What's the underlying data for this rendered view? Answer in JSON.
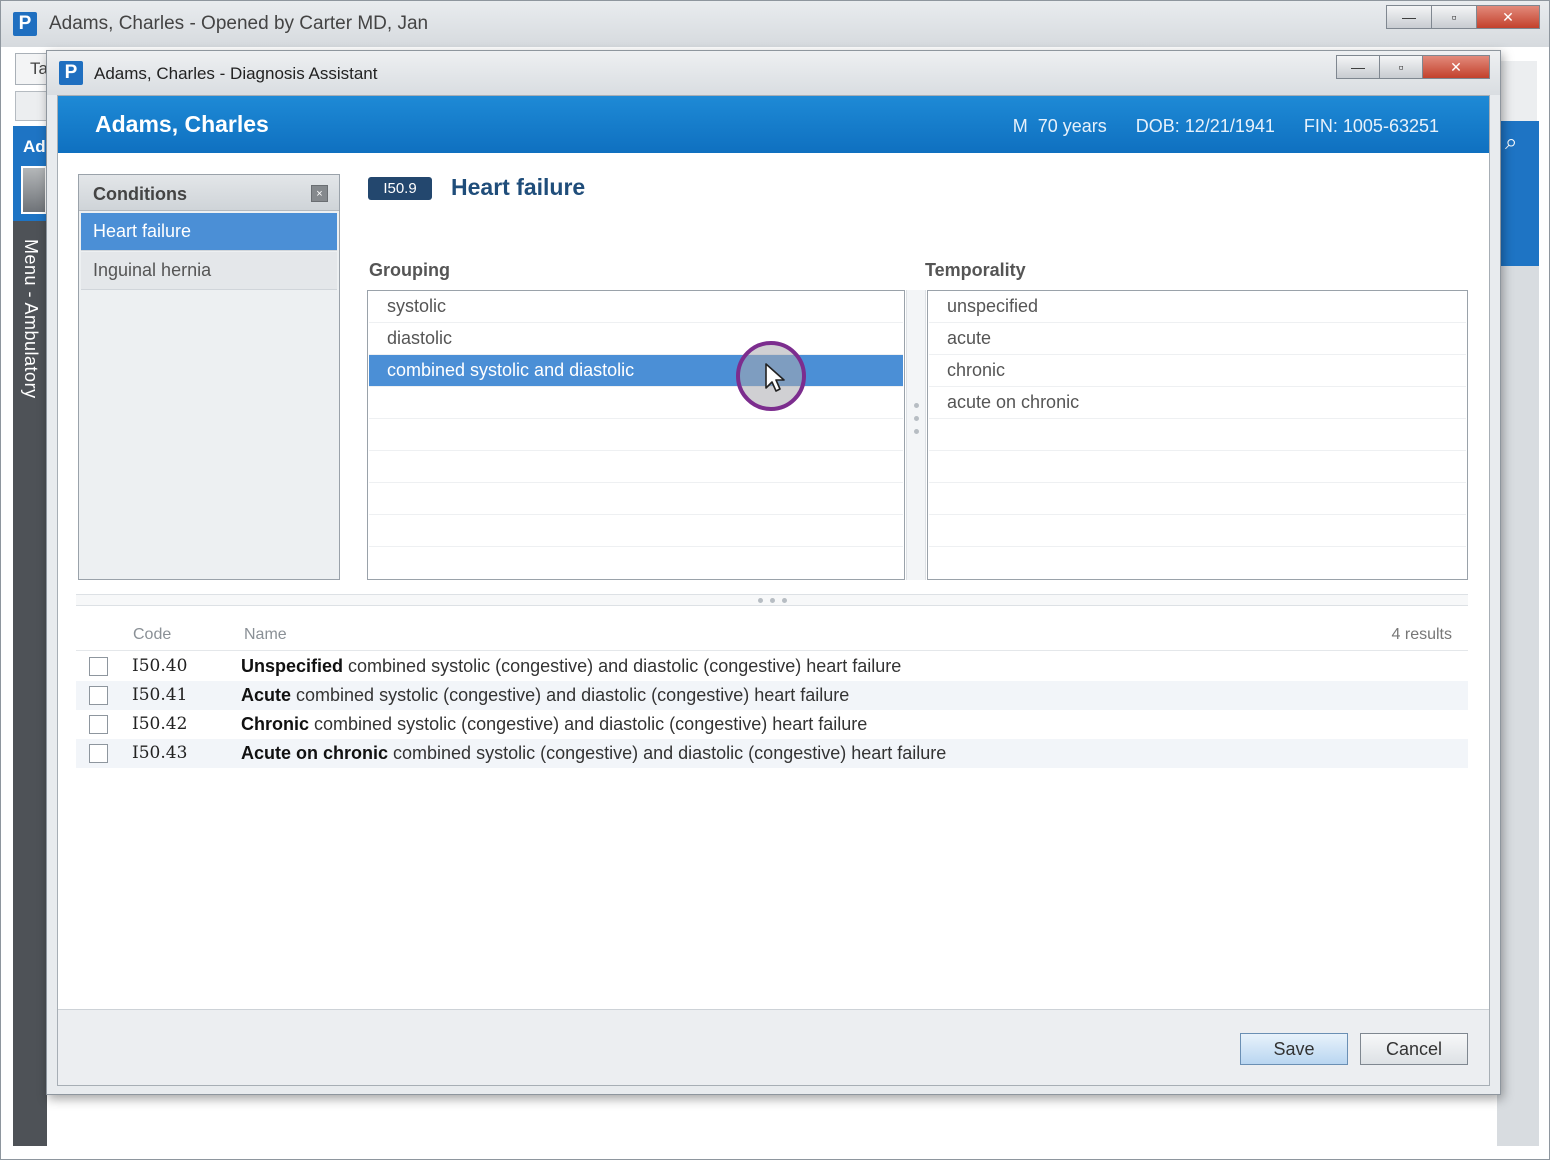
{
  "outer_window": {
    "title": "Adams, Charles - Opened by Carter MD, Jan",
    "tab_fragment": "Ta",
    "side_fragment": "Ad",
    "side_menu": "Menu - Ambulatory",
    "controls": {
      "minimize": "—",
      "maximize": "▫",
      "close": "✕"
    }
  },
  "dialog": {
    "title": "Adams, Charles - Diagnosis Assistant",
    "controls": {
      "minimize": "—",
      "maximize": "▫",
      "close": "✕"
    },
    "banner": {
      "patient_name": "Adams, Charles",
      "sex_age": "M  70 years",
      "dob": "DOB: 12/21/1941",
      "fin": "FIN: 1005-63251"
    },
    "conditions": {
      "header": "Conditions",
      "close_icon": "×",
      "items": [
        {
          "label": "Heart failure",
          "selected": true
        },
        {
          "label": "Inguinal hernia",
          "selected": false
        }
      ]
    },
    "selected_condition": {
      "code": "I50.9",
      "name": "Heart failure"
    },
    "grouping": {
      "label": "Grouping",
      "options": [
        {
          "label": "systolic",
          "selected": false
        },
        {
          "label": "diastolic",
          "selected": false
        },
        {
          "label": "combined systolic and diastolic",
          "selected": true
        }
      ]
    },
    "temporality": {
      "label": "Temporality",
      "options": [
        {
          "label": "unspecified"
        },
        {
          "label": "acute"
        },
        {
          "label": "chronic"
        },
        {
          "label": "acute on chronic"
        }
      ]
    },
    "results": {
      "columns": {
        "code": "Code",
        "name": "Name"
      },
      "count": "4 results",
      "rows": [
        {
          "code": "I50.40",
          "bold": "Unspecified",
          "rest": " combined systolic (congestive) and diastolic (congestive) heart failure",
          "checked": false
        },
        {
          "code": "I50.41",
          "bold": "Acute",
          "rest": " combined systolic (congestive) and diastolic (congestive) heart failure",
          "checked": false
        },
        {
          "code": "I50.42",
          "bold": "Chronic",
          "rest": " combined systolic (congestive) and diastolic (congestive) heart failure",
          "checked": false
        },
        {
          "code": "I50.43",
          "bold": "Acute on chronic",
          "rest": " combined systolic (congestive) and diastolic (congestive) heart failure",
          "checked": false
        }
      ]
    },
    "buttons": {
      "save": "Save",
      "cancel": "Cancel"
    }
  },
  "colors": {
    "banner": "#1179c9",
    "selection": "#4b8fd6",
    "code_badge": "#23476e",
    "cursor_ring": "#7c2d8e"
  }
}
